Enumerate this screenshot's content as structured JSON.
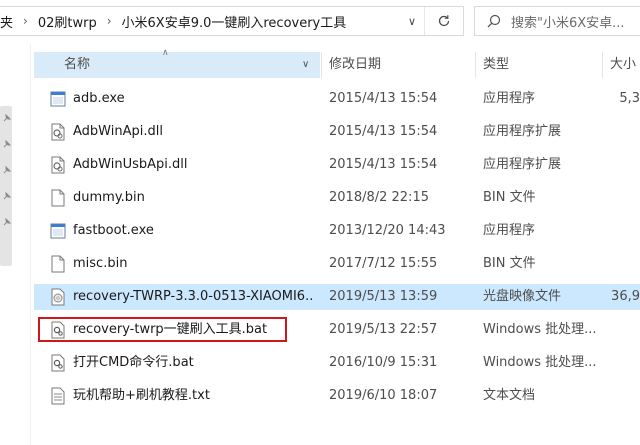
{
  "address": {
    "crumbs": [
      "夹",
      "02刷twrp",
      "小米6X安卓9.0一键刷入recovery工具"
    ],
    "separator": "›"
  },
  "search": {
    "placeholder": "搜索\"小米6X安卓..."
  },
  "columns": {
    "name": "名称",
    "date": "修改日期",
    "type": "类型",
    "size": "大小"
  },
  "files": [
    {
      "name": "adb.exe",
      "date": "2015/4/13 15:54",
      "type": "应用程序",
      "size": "5,3",
      "icon": "exe-icon"
    },
    {
      "name": "AdbWinApi.dll",
      "date": "2015/4/13 15:54",
      "type": "应用程序扩展",
      "size": "",
      "icon": "dll-icon"
    },
    {
      "name": "AdbWinUsbApi.dll",
      "date": "2015/4/13 15:54",
      "type": "应用程序扩展",
      "size": "",
      "icon": "dll-icon"
    },
    {
      "name": "dummy.bin",
      "date": "2018/8/2 22:15",
      "type": "BIN 文件",
      "size": "",
      "icon": "file-icon"
    },
    {
      "name": "fastboot.exe",
      "date": "2013/12/20 14:43",
      "type": "应用程序",
      "size": "",
      "icon": "exe-icon"
    },
    {
      "name": "misc.bin",
      "date": "2017/7/12 15:55",
      "type": "BIN 文件",
      "size": "",
      "icon": "file-icon"
    },
    {
      "name": "recovery-TWRP-3.3.0-0513-XIAOMI6...",
      "date": "2019/5/13 13:59",
      "type": "光盘映像文件",
      "size": "36,9",
      "icon": "disc-image-icon",
      "selected": true
    },
    {
      "name": "recovery-twrp一键刷入工具.bat",
      "date": "2019/5/13 22:57",
      "type": "Windows 批处理...",
      "size": "",
      "icon": "bat-icon",
      "highlighted": true
    },
    {
      "name": "打开CMD命令行.bat",
      "date": "2016/10/9 15:31",
      "type": "Windows 批处理...",
      "size": "",
      "icon": "bat-icon"
    },
    {
      "name": "玩机帮助+刷机教程.txt",
      "date": "2019/6/10 18:07",
      "type": "文本文档",
      "size": "",
      "icon": "txt-icon"
    }
  ],
  "colors": {
    "selected_row": "#cce8ff",
    "header_highlight": "#d9ebf9",
    "annotation_box": "#d0161b"
  }
}
